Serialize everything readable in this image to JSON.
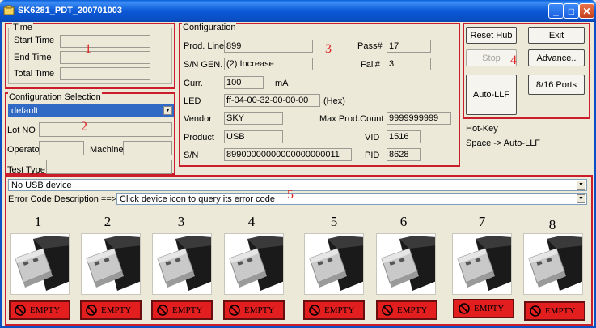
{
  "window": {
    "title": "SK6281_PDT_200701003"
  },
  "annotations": [
    "1",
    "2",
    "3",
    "4",
    "5"
  ],
  "time": {
    "group_label": "Time",
    "start_label": "Start Time",
    "end_label": "End Time",
    "total_label": "Total Time",
    "start_value": "",
    "end_value": "",
    "total_value": ""
  },
  "config_selection": {
    "group_label": "Configuration Selection",
    "selected": "default",
    "lot_label": "Lot NO",
    "operator_label": "Operator",
    "machine_label": "Machine",
    "test_type_label": "Test Type",
    "lot_value": "",
    "operator_value": "",
    "machine_value": "",
    "test_type_value": ""
  },
  "configuration": {
    "group_label": "Configuration",
    "prod_line_label": "Prod. Line",
    "prod_line_value": "899",
    "pass_label": "Pass#",
    "pass_value": "17",
    "sn_gen_label": "S/N GEN.",
    "sn_gen_value": "(2) Increase",
    "fail_label": "Fail#",
    "fail_value": "3",
    "curr_label": "Curr.",
    "curr_value": "100",
    "curr_unit": "mA",
    "led_label": "LED",
    "led_value": "ff-04-00-32-00-00-00",
    "led_unit": "(Hex)",
    "vendor_label": "Vendor",
    "vendor_value": "SKY",
    "max_prod_label": "Max Prod.Count",
    "max_prod_value": "9999999999",
    "product_label": "Product",
    "product_value": "USB",
    "vid_label": "VID",
    "vid_value": "1516",
    "sn_label": "S/N",
    "sn_value": "89900000000000000000011",
    "pid_label": "PID",
    "pid_value": "8628"
  },
  "buttons": {
    "reset_hub": "Reset Hub",
    "exit": "Exit",
    "stop": "Stop",
    "advance": "Advance..",
    "auto_llf": "Auto-LLF",
    "ports": "8/16 Ports"
  },
  "hotkey": {
    "title": "Hot-Key",
    "line": "Space -> Auto-LLF"
  },
  "device_panel": {
    "device_select": "No USB device",
    "error_label": "Error Code Description ==>",
    "error_select": "Click device icon to query its error code"
  },
  "slots": [
    {
      "number": "1",
      "status": "EMPTY"
    },
    {
      "number": "2",
      "status": "EMPTY"
    },
    {
      "number": "3",
      "status": "EMPTY"
    },
    {
      "number": "4",
      "status": "EMPTY"
    },
    {
      "number": "5",
      "status": "EMPTY"
    },
    {
      "number": "6",
      "status": "EMPTY"
    },
    {
      "number": "7",
      "status": "EMPTY"
    },
    {
      "number": "8",
      "status": "EMPTY"
    }
  ],
  "icons": {
    "app": "app-icon",
    "minimize": "minimize-icon",
    "maximize": "maximize-icon",
    "close": "close-icon",
    "usb": "usb-drive-icon",
    "no_entry": "no-entry-icon"
  },
  "colors": {
    "titlebar": "#0a5fd8",
    "highlight_box": "#cc1d2a",
    "empty_status": "#e21e1e",
    "selection": "#316ac5"
  }
}
